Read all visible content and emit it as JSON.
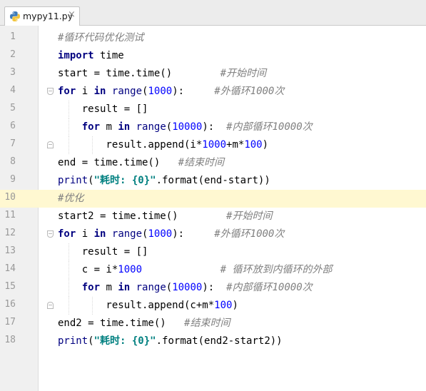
{
  "tab": {
    "filename": "mypy11.py",
    "close_glyph": "×",
    "icon": "python-file-icon"
  },
  "caret_line": 10,
  "lines": [
    {
      "num": "1",
      "tokens": [
        {
          "t": "cmt",
          "v": "#循环代码优化测试"
        }
      ]
    },
    {
      "num": "2",
      "tokens": [
        {
          "t": "kw",
          "v": "import"
        },
        {
          "t": "plain",
          "v": " time"
        }
      ]
    },
    {
      "num": "3",
      "tokens": [
        {
          "t": "plain",
          "v": "start = time.time()        "
        },
        {
          "t": "cmt",
          "v": "#开始时间"
        }
      ]
    },
    {
      "num": "4",
      "tokens": [
        {
          "t": "kw",
          "v": "for"
        },
        {
          "t": "plain",
          "v": " i "
        },
        {
          "t": "kw",
          "v": "in"
        },
        {
          "t": "plain",
          "v": " "
        },
        {
          "t": "bi",
          "v": "range"
        },
        {
          "t": "plain",
          "v": "("
        },
        {
          "t": "num",
          "v": "1000"
        },
        {
          "t": "plain",
          "v": "):     "
        },
        {
          "t": "cmt",
          "v": "#外循环1000次"
        }
      ]
    },
    {
      "num": "5",
      "tokens": [
        {
          "t": "plain",
          "v": "    result = []"
        }
      ]
    },
    {
      "num": "6",
      "tokens": [
        {
          "t": "plain",
          "v": "    "
        },
        {
          "t": "kw",
          "v": "for"
        },
        {
          "t": "plain",
          "v": " m "
        },
        {
          "t": "kw",
          "v": "in"
        },
        {
          "t": "plain",
          "v": " "
        },
        {
          "t": "bi",
          "v": "range"
        },
        {
          "t": "plain",
          "v": "("
        },
        {
          "t": "num",
          "v": "10000"
        },
        {
          "t": "plain",
          "v": "):  "
        },
        {
          "t": "cmt",
          "v": "#内部循环10000次"
        }
      ]
    },
    {
      "num": "7",
      "tokens": [
        {
          "t": "plain",
          "v": "        result.append(i*"
        },
        {
          "t": "num",
          "v": "1000"
        },
        {
          "t": "plain",
          "v": "+m*"
        },
        {
          "t": "num",
          "v": "100"
        },
        {
          "t": "plain",
          "v": ")"
        }
      ]
    },
    {
      "num": "8",
      "tokens": [
        {
          "t": "plain",
          "v": "end = time.time()   "
        },
        {
          "t": "cmt",
          "v": "#结束时间"
        }
      ]
    },
    {
      "num": "9",
      "tokens": [
        {
          "t": "bi",
          "v": "print"
        },
        {
          "t": "plain",
          "v": "("
        },
        {
          "t": "str",
          "v": "\"耗时: {0}\""
        },
        {
          "t": "plain",
          "v": ".format(end-start))"
        }
      ]
    },
    {
      "num": "10",
      "tokens": [
        {
          "t": "cmt",
          "v": "#优化"
        }
      ]
    },
    {
      "num": "11",
      "tokens": [
        {
          "t": "plain",
          "v": "start2 = time.time()        "
        },
        {
          "t": "cmt",
          "v": "#开始时间"
        }
      ]
    },
    {
      "num": "12",
      "tokens": [
        {
          "t": "kw",
          "v": "for"
        },
        {
          "t": "plain",
          "v": " i "
        },
        {
          "t": "kw",
          "v": "in"
        },
        {
          "t": "plain",
          "v": " "
        },
        {
          "t": "bi",
          "v": "range"
        },
        {
          "t": "plain",
          "v": "("
        },
        {
          "t": "num",
          "v": "1000"
        },
        {
          "t": "plain",
          "v": "):     "
        },
        {
          "t": "cmt",
          "v": "#外循环1000次"
        }
      ]
    },
    {
      "num": "13",
      "tokens": [
        {
          "t": "plain",
          "v": "    result = []"
        }
      ]
    },
    {
      "num": "14",
      "tokens": [
        {
          "t": "plain",
          "v": "    c = i*"
        },
        {
          "t": "num",
          "v": "1000"
        },
        {
          "t": "plain",
          "v": "             "
        },
        {
          "t": "cmt",
          "v": "# 循环放到内循环的外部"
        }
      ]
    },
    {
      "num": "15",
      "tokens": [
        {
          "t": "plain",
          "v": "    "
        },
        {
          "t": "kw",
          "v": "for"
        },
        {
          "t": "plain",
          "v": " m "
        },
        {
          "t": "kw",
          "v": "in"
        },
        {
          "t": "plain",
          "v": " "
        },
        {
          "t": "bi",
          "v": "range"
        },
        {
          "t": "plain",
          "v": "("
        },
        {
          "t": "num",
          "v": "10000"
        },
        {
          "t": "plain",
          "v": "):  "
        },
        {
          "t": "cmt",
          "v": "#内部循环10000次"
        }
      ]
    },
    {
      "num": "16",
      "tokens": [
        {
          "t": "plain",
          "v": "        result.append(c+m*"
        },
        {
          "t": "num",
          "v": "100"
        },
        {
          "t": "plain",
          "v": ")"
        }
      ]
    },
    {
      "num": "17",
      "tokens": [
        {
          "t": "plain",
          "v": "end2 = time.time()   "
        },
        {
          "t": "cmt",
          "v": "#结束时间"
        }
      ]
    },
    {
      "num": "18",
      "tokens": [
        {
          "t": "bi",
          "v": "print"
        },
        {
          "t": "plain",
          "v": "("
        },
        {
          "t": "str",
          "v": "\"耗时: {0}\""
        },
        {
          "t": "plain",
          "v": ".format(end2-start2))"
        }
      ]
    }
  ],
  "colors": {
    "keyword": "#000080",
    "number": "#0000ff",
    "string": "#008080",
    "comment": "#808080",
    "caret_row": "#fff8d1"
  }
}
